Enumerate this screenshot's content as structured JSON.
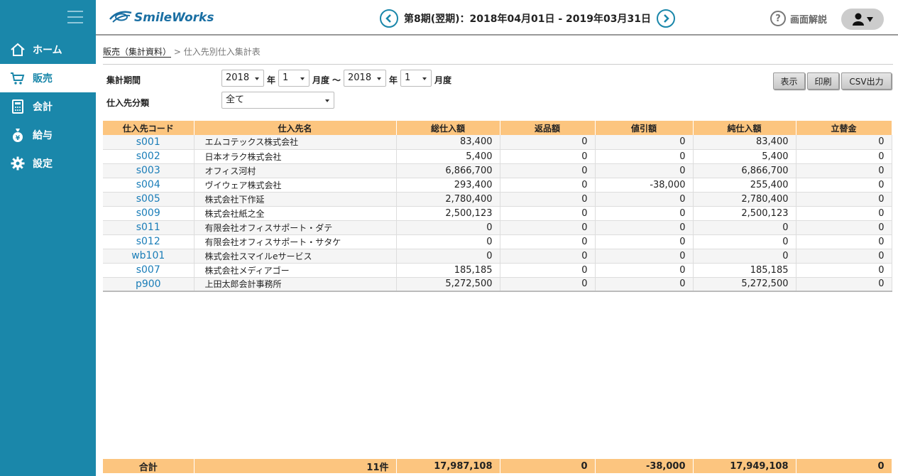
{
  "sidebar": {
    "items": [
      {
        "label": "ホーム",
        "icon": "home-icon"
      },
      {
        "label": "販売",
        "icon": "cart-icon"
      },
      {
        "label": "会計",
        "icon": "calculator-icon"
      },
      {
        "label": "給与",
        "icon": "money-bag-icon"
      },
      {
        "label": "設定",
        "icon": "gear-icon"
      }
    ],
    "active_index": 1
  },
  "header": {
    "logo_text": "SmileWorks",
    "period": "第8期(翌期)：2018年04月01日 - 2019年03月31日",
    "help_label": "画面解説"
  },
  "breadcrumb": {
    "parent": "販売（集計資料）",
    "separator": ">",
    "current": "仕入先別仕入集計表"
  },
  "filters": {
    "period_label": "集計期間",
    "from_year": "2018",
    "year_unit": "年",
    "from_month": "1",
    "month_unit": "月度",
    "range_sep": "〜",
    "to_year": "2018",
    "to_month": "1",
    "category_label": "仕入先分類",
    "category_value": "全て"
  },
  "buttons": {
    "show": "表示",
    "print": "印刷",
    "csv": "CSV出力"
  },
  "table": {
    "headers": [
      "仕入先コード",
      "仕入先名",
      "総仕入額",
      "返品額",
      "値引額",
      "純仕入額",
      "立替金"
    ],
    "rows": [
      [
        "s001",
        "エムコテックス株式会社",
        "83,400",
        "0",
        "0",
        "83,400",
        "0"
      ],
      [
        "s002",
        "日本オラク株式会社",
        "5,400",
        "0",
        "0",
        "5,400",
        "0"
      ],
      [
        "s003",
        "オフィス河村",
        "6,866,700",
        "0",
        "0",
        "6,866,700",
        "0"
      ],
      [
        "s004",
        "ヴイウェア株式会社",
        "293,400",
        "0",
        "-38,000",
        "255,400",
        "0"
      ],
      [
        "s005",
        "株式会社下作延",
        "2,780,400",
        "0",
        "0",
        "2,780,400",
        "0"
      ],
      [
        "s009",
        "株式会社紙之全",
        "2,500,123",
        "0",
        "0",
        "2,500,123",
        "0"
      ],
      [
        "s011",
        "有限会社オフィスサポート・ダテ",
        "0",
        "0",
        "0",
        "0",
        "0"
      ],
      [
        "s012",
        "有限会社オフィスサポート・サタケ",
        "0",
        "0",
        "0",
        "0",
        "0"
      ],
      [
        "wb101",
        "株式会社スマイルeサービス",
        "0",
        "0",
        "0",
        "0",
        "0"
      ],
      [
        "s007",
        "株式会社メディアゴー",
        "185,185",
        "0",
        "0",
        "185,185",
        "0"
      ],
      [
        "p900",
        "上田太郎会計事務所",
        "5,272,500",
        "0",
        "0",
        "5,272,500",
        "0"
      ]
    ]
  },
  "totals": {
    "label": "合計",
    "count": "11件",
    "gross": "17,987,108",
    "returns": "0",
    "discount": "-38,000",
    "net": "17,949,108",
    "advance": "0"
  },
  "colors": {
    "sidebar_bg": "#1a87aa",
    "header_row_bg": "#fcc57f",
    "link": "#1a7db8"
  }
}
